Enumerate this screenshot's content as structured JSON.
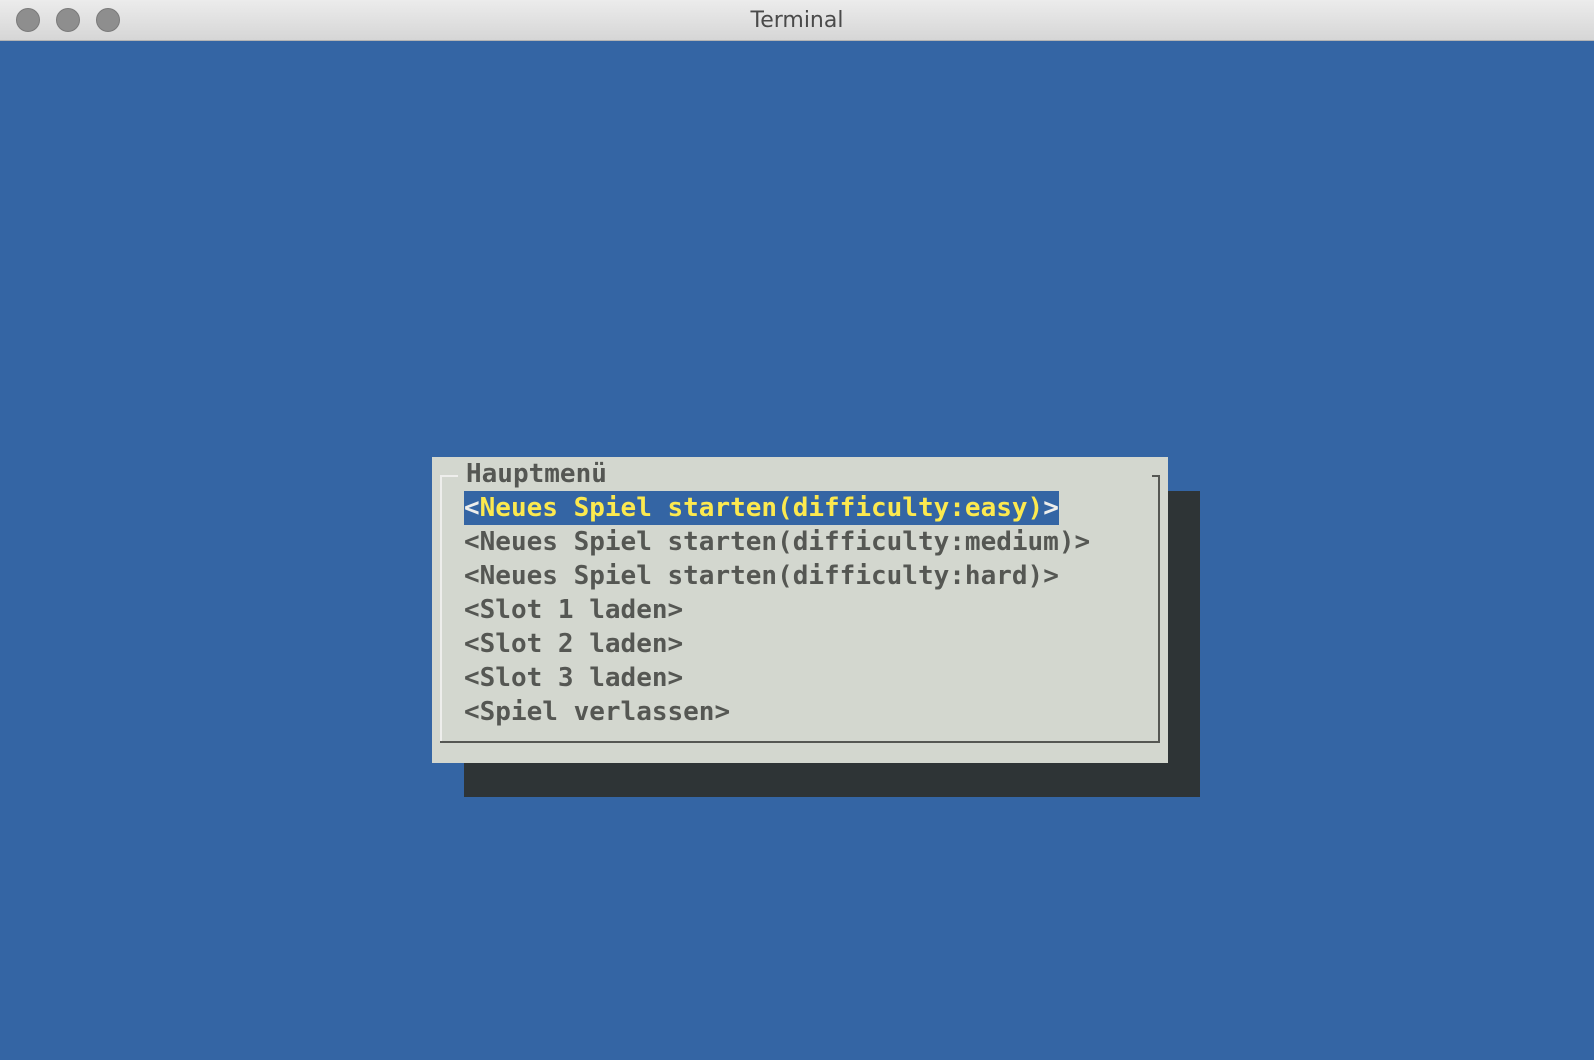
{
  "window": {
    "title": "Terminal"
  },
  "colors": {
    "terminal_background": "#3465a4",
    "dialog_background": "#d3d7cf",
    "shadow": "#2e3436",
    "selected_background": "#3465a4",
    "selected_text": "#fce94f",
    "text": "#555753"
  },
  "dialog": {
    "title": "Hauptmenü",
    "bracket_open": "<",
    "bracket_close": ">",
    "items": [
      {
        "label": "Neues Spiel starten(difficulty:easy)",
        "selected": true
      },
      {
        "label": "Neues Spiel starten(difficulty:medium)",
        "selected": false
      },
      {
        "label": "Neues Spiel starten(difficulty:hard)",
        "selected": false
      },
      {
        "label": "Slot 1 laden",
        "selected": false
      },
      {
        "label": "Slot 2 laden",
        "selected": false
      },
      {
        "label": "Slot 3 laden",
        "selected": false
      },
      {
        "label": "Spiel verlassen",
        "selected": false
      }
    ]
  }
}
